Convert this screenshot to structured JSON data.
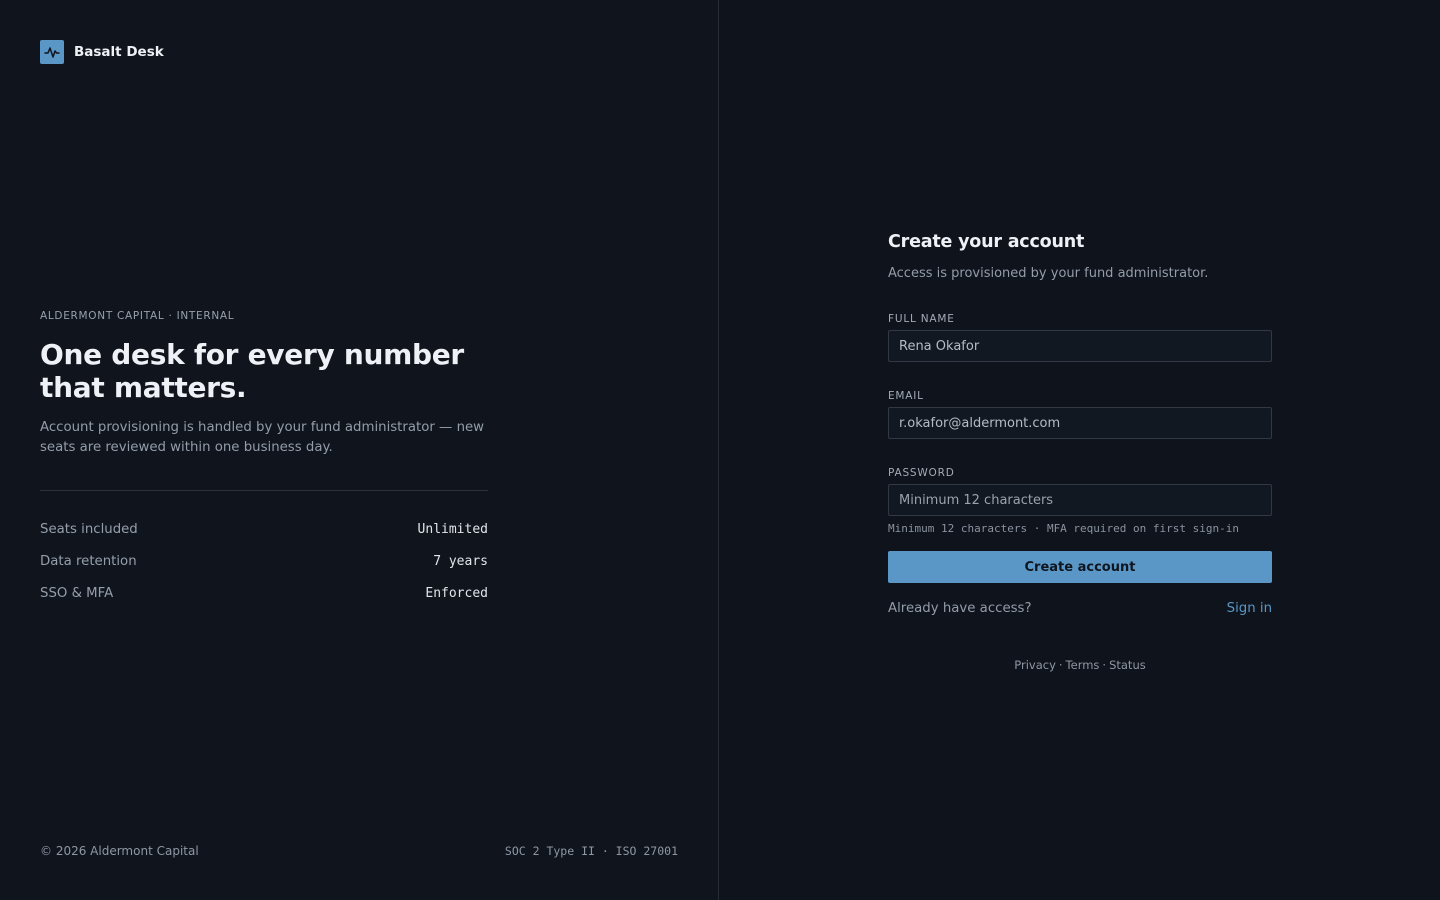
{
  "brand": {
    "name": "Basalt Desk",
    "accent": "#5b97c6",
    "icon": "pulse-icon"
  },
  "hero": {
    "eyebrow": "ALDERMONT CAPITAL · INTERNAL",
    "headline": "One desk for every number that matters.",
    "lede": "Account provisioning is handled by your fund administrator — new seats are reviewed within one business day."
  },
  "facts": [
    {
      "label": "Seats included",
      "value": "Unlimited"
    },
    {
      "label": "Data retention",
      "value": "7 years"
    },
    {
      "label": "SSO & MFA",
      "value": "Enforced"
    }
  ],
  "footer_left": {
    "copyright": "© 2026 Aldermont Capital",
    "compliance": "SOC 2 Type II · ISO 27001"
  },
  "form": {
    "title": "Create your account",
    "subtitle": "Access is provisioned by your fund administrator.",
    "full_name": {
      "label": "FULL NAME",
      "value": "Rena Okafor",
      "placeholder": ""
    },
    "email": {
      "label": "EMAIL",
      "value": "r.okafor@aldermont.com",
      "placeholder": ""
    },
    "password": {
      "label": "PASSWORD",
      "value": "",
      "placeholder": "Minimum 12 characters"
    },
    "password_hint": "Minimum 12 characters · MFA required on first sign-in",
    "submit_label": "Create account",
    "signin_prompt": "Already have access?",
    "signin_link": "Sign in"
  },
  "footer_links": {
    "privacy": "Privacy",
    "terms": "Terms",
    "status": "Status",
    "separator": "·"
  }
}
